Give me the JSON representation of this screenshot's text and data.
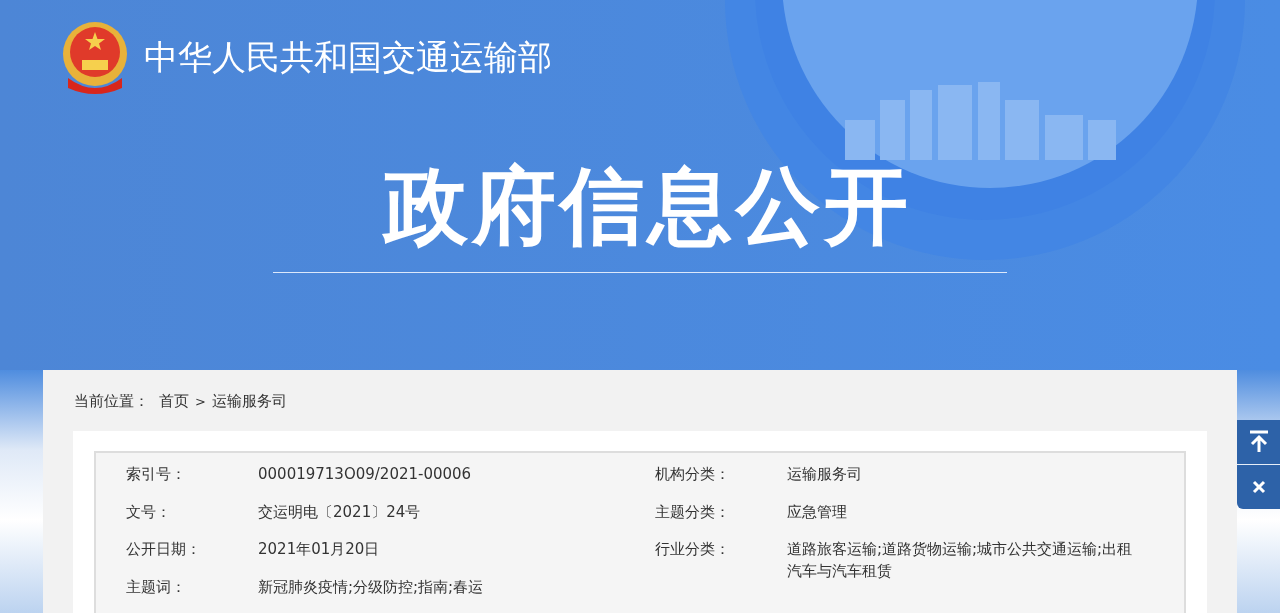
{
  "header": {
    "ministry": "中华人民共和国交通运输部",
    "title": "政府信息公开"
  },
  "breadcrumb": {
    "label": "当前位置：",
    "separator": ">",
    "items": [
      "首页",
      "运输服务司"
    ]
  },
  "info": {
    "left": [
      {
        "label": "索引号：",
        "value": "000019713O09/2021-00006"
      },
      {
        "label": "文号：",
        "value": "交运明电〔2021〕24号"
      },
      {
        "label": "公开日期：",
        "value": "2021年01月20日"
      },
      {
        "label": "主题词：",
        "value": "新冠肺炎疫情;分级防控;指南;春运"
      }
    ],
    "right": [
      {
        "label": "机构分类：",
        "value": "运输服务司"
      },
      {
        "label": "主题分类：",
        "value": "应急管理"
      },
      {
        "label": "行业分类：",
        "value": "道路旅客运输;道路货物运输;城市公共交通运输;出租汽车与汽车租赁"
      }
    ]
  },
  "side_buttons": [
    {
      "kind": "top"
    },
    {
      "kind": "close"
    }
  ]
}
